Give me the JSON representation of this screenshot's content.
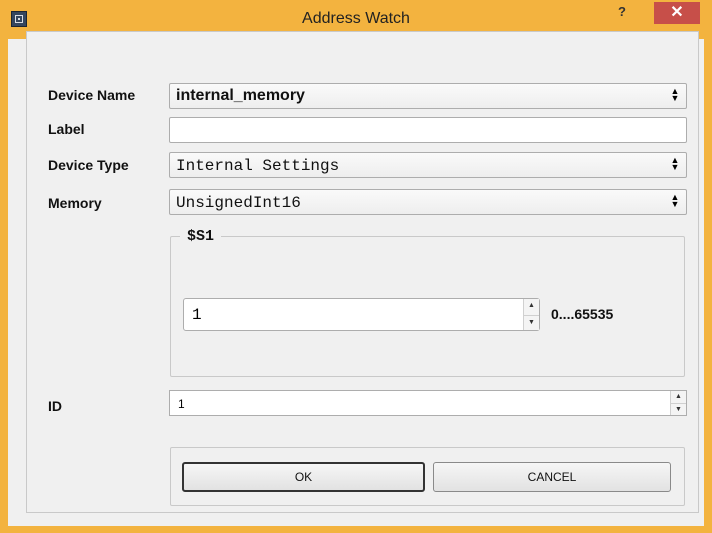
{
  "window": {
    "title": "Address Watch",
    "help": "?",
    "close": "✕"
  },
  "form": {
    "device_name": {
      "label": "Device Name",
      "value": "internal_memory"
    },
    "label": {
      "label": "Label",
      "value": ""
    },
    "device_type": {
      "label": "Device Type",
      "value": "Internal Settings"
    },
    "memory": {
      "label": "Memory",
      "value": "UnsignedInt16"
    },
    "group": {
      "title": "$S1",
      "value": "1",
      "range": "0....65535"
    },
    "id": {
      "label": "ID",
      "value": "1"
    }
  },
  "buttons": {
    "ok": "OK",
    "cancel": "CANCEL"
  },
  "icons": {
    "app": "address-watch-app-icon",
    "help": "help-icon",
    "close": "close-icon",
    "combo": "combo-arrows-icon",
    "spin": "spin-arrows-icon"
  },
  "colors": {
    "titlebar": "#f3b33f",
    "close": "#c74f49",
    "dialog_bg": "#f0f0f0"
  }
}
